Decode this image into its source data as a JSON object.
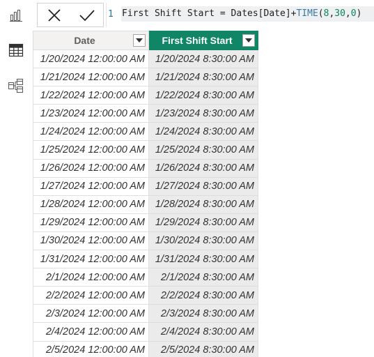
{
  "formula_bar": {
    "line_number": "1",
    "formula": "First Shift Start = Dates[Date]+TIME(8,30,0)",
    "tokens": [
      {
        "text": "First Shift Start",
        "cls": "tok-op"
      },
      {
        "text": " = ",
        "cls": "tok-op"
      },
      {
        "text": "Dates[Date]",
        "cls": "tok-op"
      },
      {
        "text": "+",
        "cls": "tok-op"
      },
      {
        "text": "TIME",
        "cls": "tok-fn"
      },
      {
        "text": "(",
        "cls": "tok-op"
      },
      {
        "text": "8",
        "cls": "tok-num"
      },
      {
        "text": ",",
        "cls": "tok-op"
      },
      {
        "text": "30",
        "cls": "tok-num"
      },
      {
        "text": ",",
        "cls": "tok-op"
      },
      {
        "text": "0",
        "cls": "tok-num"
      },
      {
        "text": ")",
        "cls": "tok-op"
      }
    ],
    "cancel_icon": "close-icon",
    "commit_icon": "checkmark-icon"
  },
  "rail": {
    "items": [
      {
        "name": "report-view",
        "icon": "bar-chart-icon"
      },
      {
        "name": "table-view",
        "icon": "table-icon"
      },
      {
        "name": "model-view",
        "icon": "model-icon"
      }
    ]
  },
  "grid": {
    "columns": [
      {
        "label": "Date",
        "key": "date"
      },
      {
        "label": "First Shift Start",
        "key": "shift",
        "selected": true
      }
    ],
    "rows": [
      {
        "date": "1/20/2024 12:00:00 AM",
        "shift": "1/20/2024 8:30:00 AM"
      },
      {
        "date": "1/21/2024 12:00:00 AM",
        "shift": "1/21/2024 8:30:00 AM"
      },
      {
        "date": "1/22/2024 12:00:00 AM",
        "shift": "1/22/2024 8:30:00 AM"
      },
      {
        "date": "1/23/2024 12:00:00 AM",
        "shift": "1/23/2024 8:30:00 AM"
      },
      {
        "date": "1/24/2024 12:00:00 AM",
        "shift": "1/24/2024 8:30:00 AM"
      },
      {
        "date": "1/25/2024 12:00:00 AM",
        "shift": "1/25/2024 8:30:00 AM"
      },
      {
        "date": "1/26/2024 12:00:00 AM",
        "shift": "1/26/2024 8:30:00 AM"
      },
      {
        "date": "1/27/2024 12:00:00 AM",
        "shift": "1/27/2024 8:30:00 AM"
      },
      {
        "date": "1/28/2024 12:00:00 AM",
        "shift": "1/28/2024 8:30:00 AM"
      },
      {
        "date": "1/29/2024 12:00:00 AM",
        "shift": "1/29/2024 8:30:00 AM"
      },
      {
        "date": "1/30/2024 12:00:00 AM",
        "shift": "1/30/2024 8:30:00 AM"
      },
      {
        "date": "1/31/2024 12:00:00 AM",
        "shift": "1/31/2024 8:30:00 AM"
      },
      {
        "date": "2/1/2024 12:00:00 AM",
        "shift": "2/1/2024 8:30:00 AM"
      },
      {
        "date": "2/2/2024 12:00:00 AM",
        "shift": "2/2/2024 8:30:00 AM"
      },
      {
        "date": "2/3/2024 12:00:00 AM",
        "shift": "2/3/2024 8:30:00 AM"
      },
      {
        "date": "2/4/2024 12:00:00 AM",
        "shift": "2/4/2024 8:30:00 AM"
      },
      {
        "date": "2/5/2024 12:00:00 AM",
        "shift": "2/5/2024 8:30:00 AM"
      }
    ]
  },
  "colors": {
    "accent_header": "#118667",
    "selected_column_bg": "#ebebeb",
    "icon_gray": "#605e5c"
  }
}
